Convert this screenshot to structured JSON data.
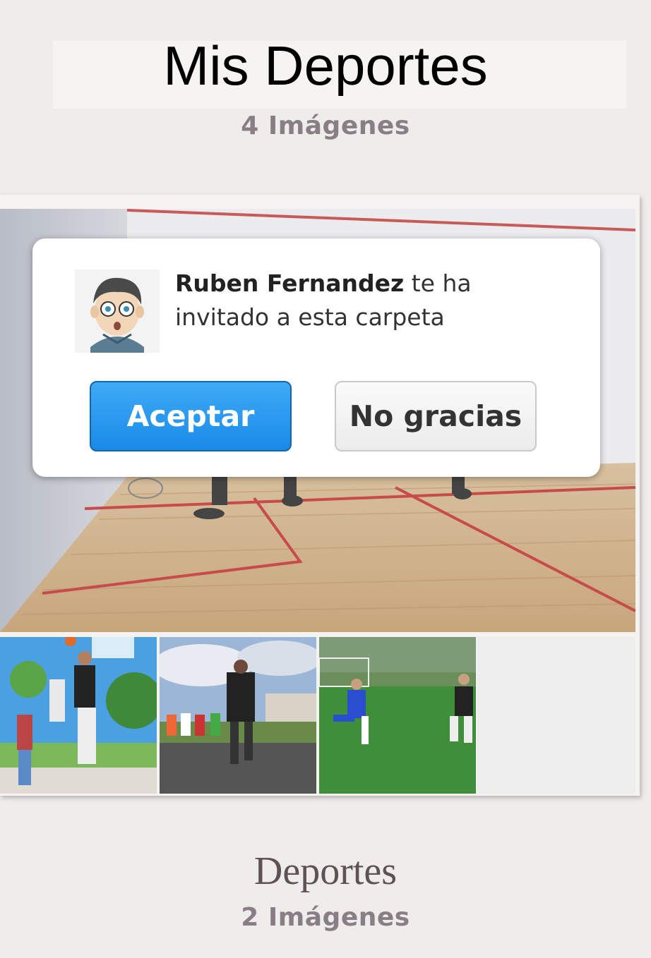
{
  "folders": [
    {
      "title": "Mis Deportes",
      "count_label": "4 Imágenes"
    },
    {
      "title": "Deportes",
      "count_label": "2 Imágenes"
    }
  ],
  "invitation": {
    "inviter_name": "Ruben Fernandez",
    "message_suffix": " te ha invitado a esta carpeta",
    "accept_label": "Aceptar",
    "decline_label": "No gracias",
    "avatar_icon": "cartoon-boy-avatar",
    "accept_color": "#1a8ae8"
  },
  "images": [
    {
      "name": "squash-court-cover"
    },
    {
      "name": "basketball-thumb"
    },
    {
      "name": "running-race-thumb"
    },
    {
      "name": "soccer-thumb"
    }
  ]
}
